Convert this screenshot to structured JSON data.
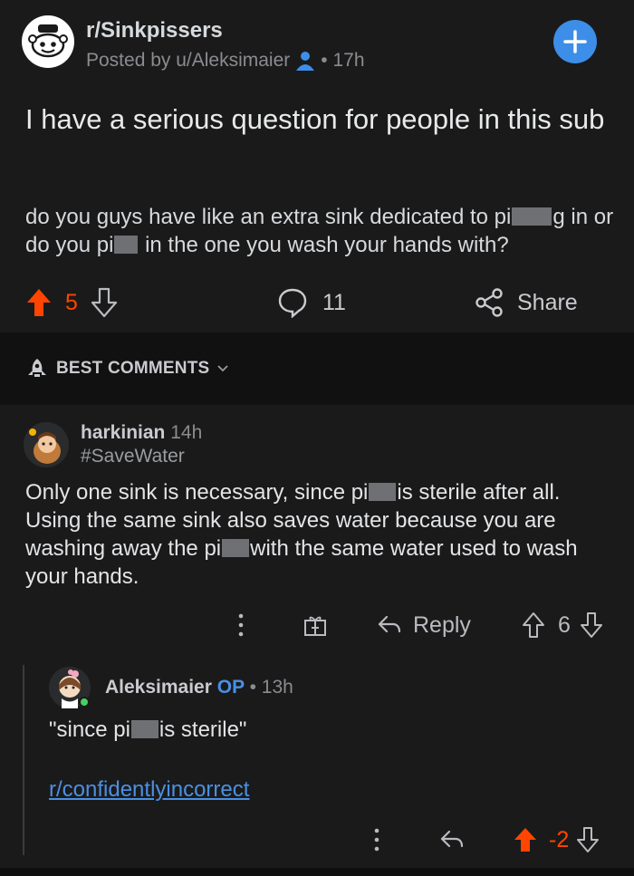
{
  "post": {
    "subreddit": "r/Sinkpissers",
    "posted_by": "Posted by u/Aleksimaier",
    "age": "• 17h",
    "title": "I have a serious question for people in this sub",
    "body_1": "do you guys have like an extra sink dedicated to pi",
    "body_2": "g",
    "body_3": "in or do you pi",
    "body_4": "in the one you wash your hands with?",
    "score": "5",
    "comments": "11",
    "share_label": "Share"
  },
  "sort": {
    "label": "BEST COMMENTS"
  },
  "comment": {
    "author": "harkinian",
    "age": "14h",
    "flair": "#SaveWater",
    "body_1": "Only one sink is necessary, since pi",
    "body_2": "is sterile after all. Using the same sink also saves water because you are washing away the pi",
    "body_3": "with the same water used to wash your hands.",
    "reply_label": "Reply",
    "score": "6"
  },
  "reply": {
    "author": "Aleksimaier",
    "op_badge": "OP",
    "age": "• 13h",
    "body_1": "\"since pi",
    "body_2": "is sterile\"",
    "link": "r/confidentlyincorrect",
    "score": "-2"
  },
  "colors": {
    "upvote": "#ff4500",
    "accent": "#3d8ee8",
    "link": "#4a90e2"
  },
  "icons": [
    "subreddit-snoo-icon",
    "user-icon",
    "plus-icon",
    "upvote-icon",
    "downvote-icon",
    "comment-icon",
    "share-icon",
    "rocket-icon",
    "chevron-down-icon",
    "more-icon",
    "award-icon",
    "reply-icon"
  ]
}
